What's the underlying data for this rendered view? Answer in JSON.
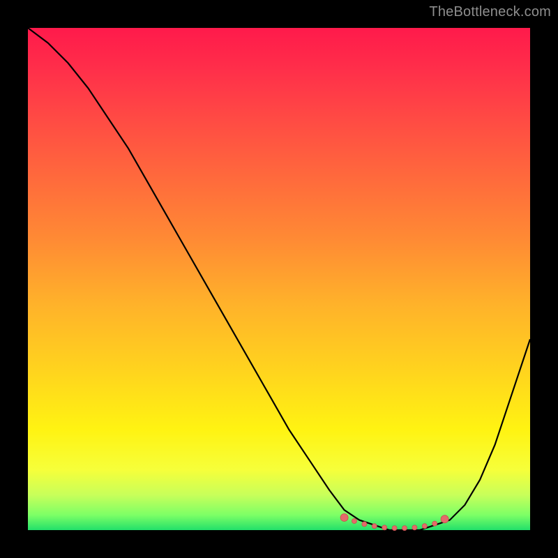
{
  "watermark": "TheBottleneck.com",
  "colors": {
    "background": "#000000",
    "curve": "#000000",
    "marker_fill": "#e46a6a",
    "marker_stroke": "#c94f4f",
    "gradient_top": "#ff1a4b",
    "gradient_bottom": "#22e06a"
  },
  "chart_data": {
    "type": "line",
    "title": "",
    "xlabel": "",
    "ylabel": "",
    "xlim": [
      0,
      100
    ],
    "ylim": [
      0,
      100
    ],
    "grid": false,
    "legend": false,
    "series": [
      {
        "name": "bottleneck-curve",
        "x": [
          0,
          4,
          8,
          12,
          16,
          20,
          24,
          28,
          32,
          36,
          40,
          44,
          48,
          52,
          56,
          60,
          63,
          66,
          69,
          72,
          75,
          78,
          81,
          84,
          87,
          90,
          93,
          96,
          100
        ],
        "y": [
          100,
          97,
          93,
          88,
          82,
          76,
          69,
          62,
          55,
          48,
          41,
          34,
          27,
          20,
          14,
          8,
          4,
          2,
          1,
          0,
          0,
          0,
          1,
          2,
          5,
          10,
          17,
          26,
          38
        ]
      }
    ],
    "markers": {
      "name": "optimal-range",
      "x": [
        63,
        65,
        67,
        69,
        71,
        73,
        75,
        77,
        79,
        81,
        83
      ],
      "y": [
        2.5,
        1.8,
        1.2,
        0.8,
        0.5,
        0.4,
        0.4,
        0.5,
        0.8,
        1.3,
        2.2
      ]
    }
  }
}
